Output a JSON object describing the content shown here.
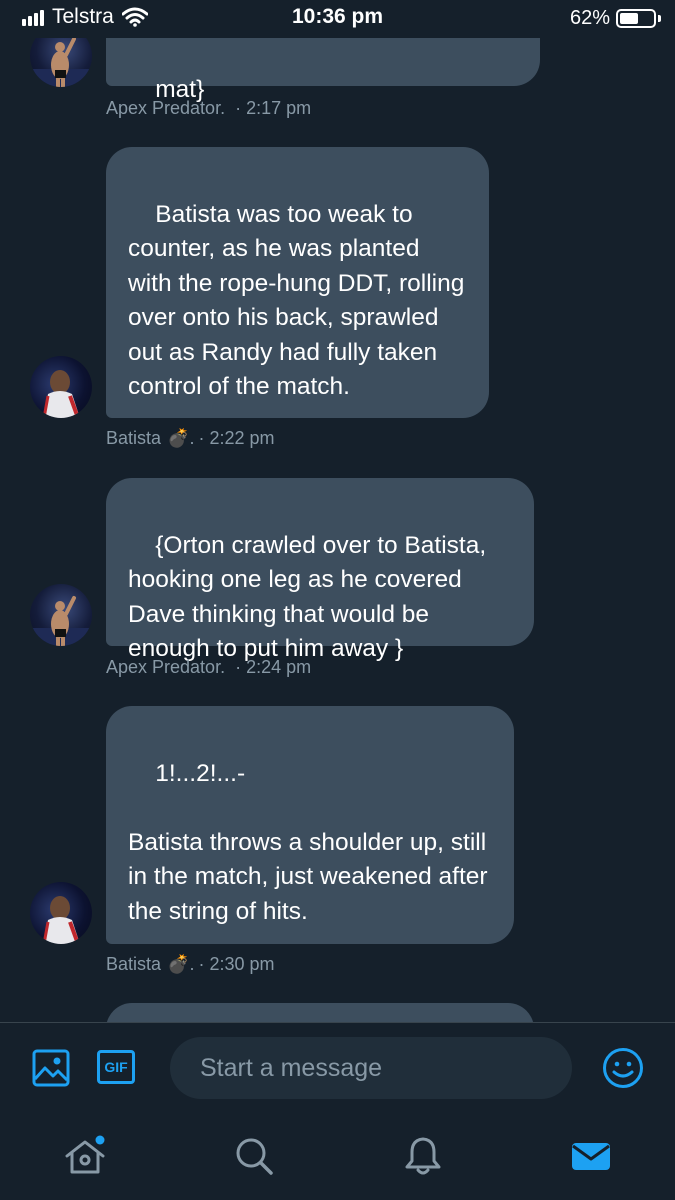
{
  "status_bar": {
    "carrier": "Telstra",
    "time": "10:36 pm",
    "battery_percent": "62%",
    "battery_level": 0.62
  },
  "messages": [
    {
      "text": "mat}",
      "sender": "Apex Predator.",
      "time": "· 2:17 pm",
      "bomb": ""
    },
    {
      "text": "Batista was too weak to counter, as he was planted with the rope-hung DDT, rolling over onto his back, sprawled out as Randy had fully taken control of the match.",
      "sender": "Batista",
      "bomb": "💣.",
      "time": "· 2:22 pm"
    },
    {
      "text": "{Orton crawled over to Batista, hooking one leg as he covered Dave thinking that would be enough to put him away }",
      "sender": "Apex Predator.",
      "time": "· 2:24 pm",
      "bomb": ""
    },
    {
      "text": "1!...2!...-\n\nBatista throws a shoulder up, still in the match, just weakened after the string of hits.",
      "sender": "Batista",
      "bomb": "💣.",
      "time": "· 2:30 pm"
    }
  ],
  "compose": {
    "placeholder": "Start a message",
    "gif_label": "GIF"
  },
  "colors": {
    "background": "#15202b",
    "bubble": "#3d4e5e",
    "accent": "#1da1f2",
    "meta_text": "#8899a6"
  },
  "icons": {
    "media": "image-icon",
    "gif": "gif-icon",
    "emoji": "emoji-icon",
    "home": "home-icon",
    "search": "search-icon",
    "notifications": "bell-icon",
    "messages": "mail-icon"
  }
}
